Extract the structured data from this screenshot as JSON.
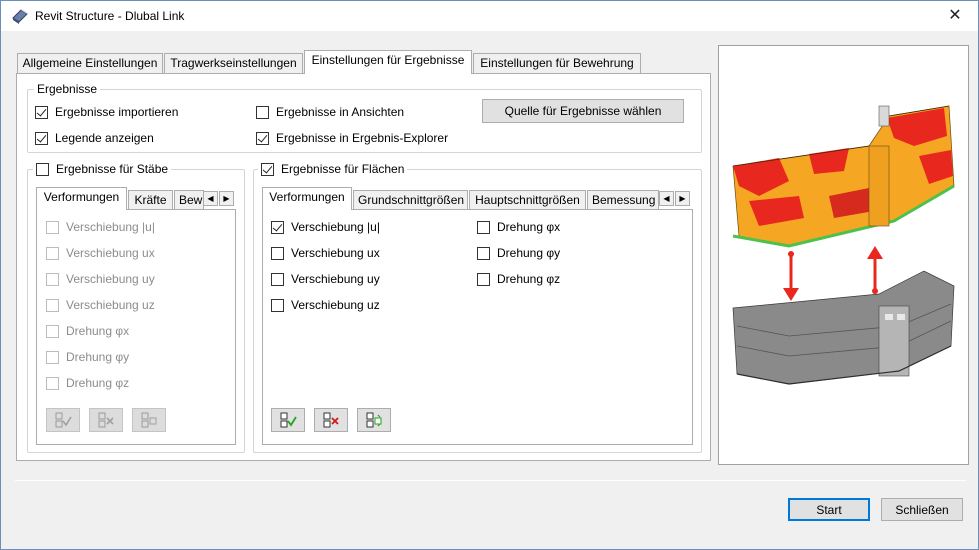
{
  "window": {
    "title": "Revit Structure - Dlubal Link",
    "close_glyph": "✕"
  },
  "main_tabs": [
    {
      "label": "Allgemeine Einstellungen"
    },
    {
      "label": "Tragwerkseinstellungen"
    },
    {
      "label": "Einstellungen für Ergebnisse"
    },
    {
      "label": "Einstellungen für Bewehrung"
    }
  ],
  "results_group": {
    "label": "Ergebnisse",
    "import_results": "Ergebnisse importieren",
    "show_legend": "Legende anzeigen",
    "results_in_views": "Ergebnisse in Ansichten",
    "results_in_explorer": "Ergebnisse in Ergebnis-Explorer",
    "source_button": "Quelle für Ergebnisse wählen"
  },
  "members_group": {
    "label": "Ergebnisse für Stäbe",
    "checked": false,
    "tabs": [
      "Verformungen",
      "Kräfte",
      "Bew"
    ],
    "items": [
      "Verschiebung |u|",
      "Verschiebung ux",
      "Verschiebung uy",
      "Verschiebung uz",
      "Drehung φx",
      "Drehung φy",
      "Drehung φz"
    ]
  },
  "surfaces_group": {
    "label": "Ergebnisse für Flächen",
    "checked": true,
    "tabs": [
      "Verformungen",
      "Grundschnittgrößen",
      "Hauptschnittgrößen",
      "Bemessung"
    ],
    "left_items": [
      "Verschiebung |u|",
      "Verschiebung ux",
      "Verschiebung uy",
      "Verschiebung uz"
    ],
    "right_items": [
      "Drehung φx",
      "Drehung φy",
      "Drehung φz"
    ]
  },
  "footer": {
    "start": "Start",
    "close": "Schließen"
  },
  "colors": {
    "accent": "#0078d7",
    "result_red": "#e8281e",
    "result_orange": "#f5a623",
    "model_gray": "#808080"
  }
}
